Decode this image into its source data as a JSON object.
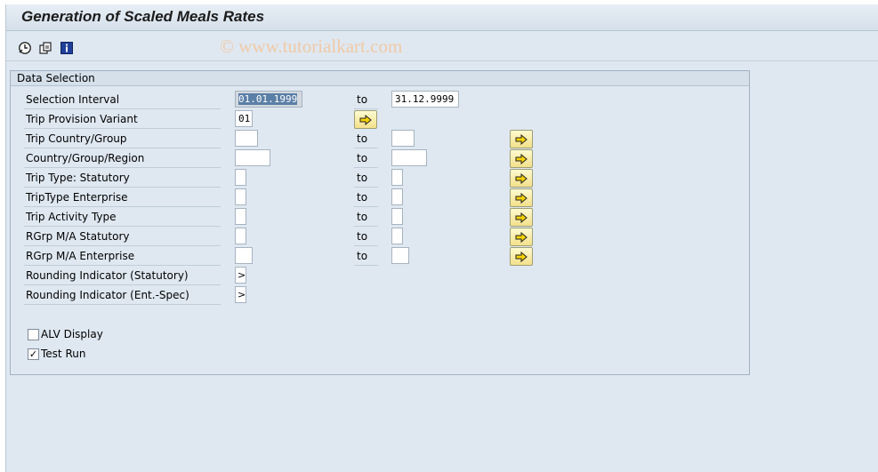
{
  "window": {
    "title": "Generation of Scaled Meals Rates"
  },
  "toolbar": {
    "icons": [
      "execute-icon",
      "get-variant-icon",
      "info-icon"
    ],
    "watermark": "© www.tutorialkart.com"
  },
  "frame": {
    "title": "Data Selection",
    "to_label": "to",
    "rows": [
      {
        "label": "Selection Interval",
        "from": "01.01.1999",
        "to": "31.12.9999"
      },
      {
        "label": "Trip Provision Variant",
        "from": "01"
      },
      {
        "label": "Trip Country/Group",
        "from": "",
        "to": ""
      },
      {
        "label": "Country/Group/Region",
        "from": "",
        "to": ""
      },
      {
        "label": "Trip Type: Statutory",
        "from": "",
        "to": ""
      },
      {
        "label": "TripType Enterprise",
        "from": "",
        "to": ""
      },
      {
        "label": "Trip Activity Type",
        "from": "",
        "to": ""
      },
      {
        "label": "RGrp M/A Statutory",
        "from": "",
        "to": ""
      },
      {
        "label": "RGrp M/A Enterprise",
        "from": "",
        "to": ""
      },
      {
        "label": "Rounding Indicator (Statutory)",
        "button": ">"
      },
      {
        "label": "Rounding Indicator (Ent.-Spec)",
        "button": ">"
      }
    ],
    "checkboxes": [
      {
        "label": "ALV Display",
        "checked": false
      },
      {
        "label": "Test Run",
        "checked": true,
        "mark": "✓"
      }
    ]
  },
  "colors": {
    "background": "#dfe8f1",
    "arrow_button": "#f3e08a",
    "selected_field": "#5b7fa6"
  }
}
